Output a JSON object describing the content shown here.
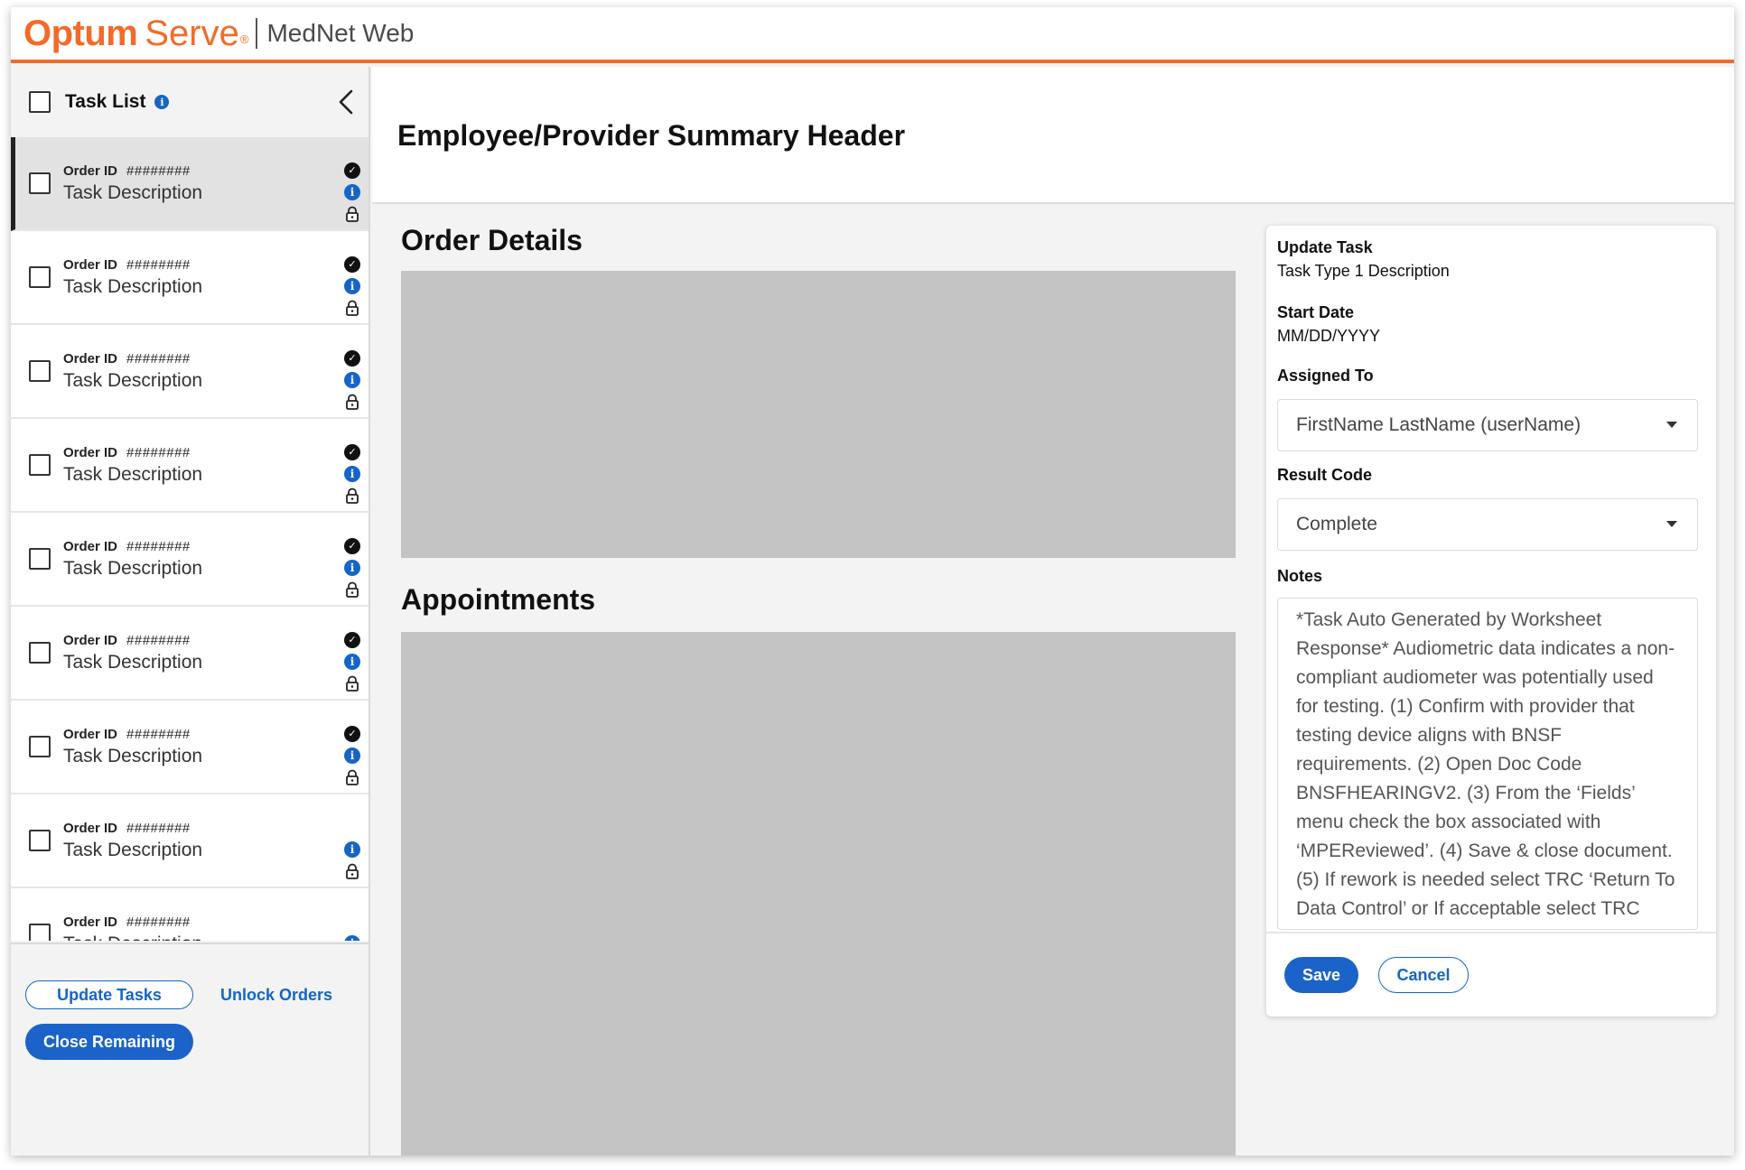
{
  "header": {
    "brand_primary": "Optum",
    "brand_secondary": "Serve",
    "brand_registered": "®",
    "app_name": "MedNet Web",
    "accent_color": "#f26b2a"
  },
  "sidebar": {
    "title": "Task List",
    "info_icon": "info-icon",
    "collapse_icon": "chevron-left-icon",
    "tasks": [
      {
        "order_label": "Order ID",
        "order_id": "########",
        "description": "Task Description",
        "icons": [
          "check-circle-icon",
          "info-icon",
          "lock-icon"
        ],
        "selected": true
      },
      {
        "order_label": "Order ID",
        "order_id": "########",
        "description": "Task Description",
        "icons": [
          "check-circle-icon",
          "info-icon",
          "lock-icon"
        ],
        "selected": false
      },
      {
        "order_label": "Order ID",
        "order_id": "########",
        "description": "Task Description",
        "icons": [
          "check-circle-icon",
          "info-icon",
          "lock-icon"
        ],
        "selected": false
      },
      {
        "order_label": "Order ID",
        "order_id": "########",
        "description": "Task Description",
        "icons": [
          "check-circle-icon",
          "info-icon",
          "lock-icon"
        ],
        "selected": false
      },
      {
        "order_label": "Order ID",
        "order_id": "########",
        "description": "Task Description",
        "icons": [
          "check-circle-icon",
          "info-icon",
          "lock-icon"
        ],
        "selected": false
      },
      {
        "order_label": "Order ID",
        "order_id": "########",
        "description": "Task Description",
        "icons": [
          "check-circle-icon",
          "info-icon",
          "lock-icon"
        ],
        "selected": false
      },
      {
        "order_label": "Order ID",
        "order_id": "########",
        "description": "Task Description",
        "icons": [
          "check-circle-icon",
          "info-icon",
          "lock-icon"
        ],
        "selected": false
      },
      {
        "order_label": "Order ID",
        "order_id": "########",
        "description": "Task Description",
        "icons": [
          "info-icon",
          "lock-icon"
        ],
        "selected": false
      },
      {
        "order_label": "Order ID",
        "order_id": "########",
        "description": "Task Description",
        "icons": [
          "info-icon",
          "lock-icon"
        ],
        "selected": false
      }
    ],
    "actions": {
      "update_tasks": "Update Tasks",
      "unlock_orders": "Unlock Orders",
      "close_remaining": "Close Remaining"
    }
  },
  "main": {
    "summary_title": "Employee/Provider Summary Header",
    "order_details_title": "Order Details",
    "appointments_title": "Appointments"
  },
  "update_task": {
    "title": "Update Task",
    "task_type": "Task Type 1 Description",
    "start_date_label": "Start Date",
    "start_date_value": "MM/DD/YYYY",
    "assigned_to_label": "Assigned To",
    "assigned_to_value": "FirstName LastName (userName)",
    "result_code_label": "Result Code",
    "result_code_value": "Complete",
    "notes_label": "Notes",
    "notes_value": "*Task Auto Generated by Worksheet Response* Audiometric data indicates a non-compliant audiometer was potentially used for testing.  (1) Confirm with provider that testing device aligns with BNSF requirements. (2) Open Doc Code BNSFHEARINGV2. (3) From the ‘Fields’ menu check the box associated with ‘MPEReviewed’. (4) Save & close document. (5) If rework is needed select TRC ‘Return To Data Control’ or If acceptable select TRC ‘Send To Clin Coord’",
    "save_label": "Save",
    "cancel_label": "Cancel"
  },
  "colors": {
    "primary_blue": "#1b63c8",
    "placeholder_gray": "#c4c4c4"
  }
}
